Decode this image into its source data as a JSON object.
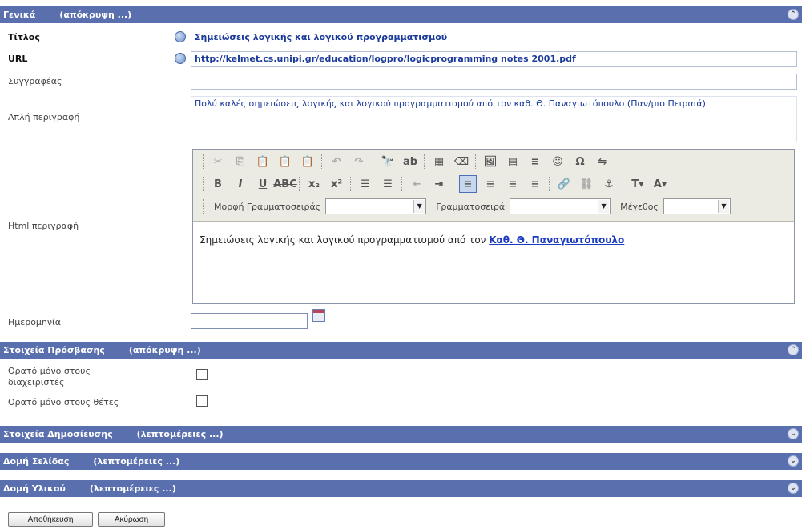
{
  "sections": {
    "general": {
      "title": "Γενικά",
      "toggle": "(απόκρυψη ...)"
    },
    "access": {
      "title": "Στοιχεία Πρόσβασης",
      "toggle": "(απόκρυψη ...)"
    },
    "publication": {
      "title": "Στοιχεία Δημοσίευσης",
      "toggle": "(λεπτομέρειες ...)"
    },
    "page_layout": {
      "title": "Δομή Σελίδας",
      "toggle": "(λεπτομέρειες ...)"
    },
    "material_layout": {
      "title": "Δομή Υλικού",
      "toggle": "(λεπτομέρειες ...)"
    }
  },
  "fields": {
    "title_label": "Τίτλος",
    "title_value": "Σημειώσεις λογικής και λογικού προγραμματισμού",
    "url_label": "URL",
    "url_value": "http://kelmet.cs.unipi.gr/education/logpro/logicprogramming notes 2001.pdf",
    "authors_label": "Συγγραφέας",
    "authors_value": "",
    "plain_desc_label": "Απλή περιγραφή",
    "plain_desc_value": "Πολύ καλές σημειώσεις λογικής και λογικού προγραμματισμού από τον καθ. Θ. Παναγιωτόπουλο (Παν/μιο Πειραιά)",
    "html_desc_label": "Html περιγραφή",
    "date_label": "Ημερομηνία",
    "date_value": ""
  },
  "editor": {
    "font_family_label": "Μορφή Γραμματοσειράς",
    "font_label": "Γραμματοσειρά",
    "size_label": "Μέγεθος",
    "content_text": "Σημειώσεις λογικής και λογικού προγραμματισμού από τον",
    "content_link": "Καθ. Θ. Παναγιωτόπουλο"
  },
  "access": {
    "admins_only_label_1": "Ορατό μόνο στους",
    "admins_only_label_2": "διαχειριστές",
    "owners_only_label": "Ορατό μόνο στους θέτες"
  },
  "buttons": {
    "save": "Αποθήκευση",
    "cancel": "Ακύρωση"
  }
}
